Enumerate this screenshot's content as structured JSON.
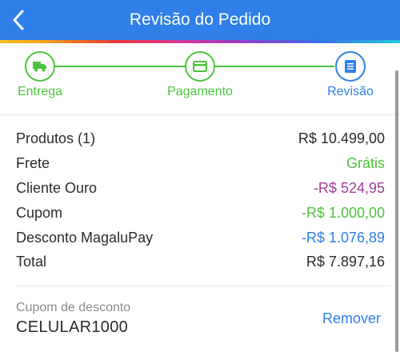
{
  "header": {
    "title": "Revisão do Pedido",
    "back_icon": "chevron-left-icon"
  },
  "steps": [
    {
      "label": "Entrega",
      "icon": "truck-icon",
      "status": "done",
      "color": "#4cc33d"
    },
    {
      "label": "Pagamento",
      "icon": "credit-card-icon",
      "status": "done",
      "color": "#4cc33d"
    },
    {
      "label": "Revisão",
      "icon": "document-icon",
      "status": "current",
      "color": "#2f7fe8"
    }
  ],
  "summary": {
    "rows": [
      {
        "label": "Produtos (1)",
        "value": "R$ 10.499,00",
        "color": "#2b2b2b"
      },
      {
        "label": "Frete",
        "value": "Grátis",
        "color": "#4cc33d"
      },
      {
        "label": "Cliente Ouro",
        "value": "-R$ 524,95",
        "color": "#9c3f97"
      },
      {
        "label": "Cupom",
        "value": "-R$ 1.000,00",
        "color": "#4cc33d"
      },
      {
        "label": "Desconto MagaluPay",
        "value": "-R$ 1.076,89",
        "color": "#2f7fe8"
      }
    ],
    "total": {
      "label": "Total",
      "value": "R$ 7.897,16"
    }
  },
  "coupon": {
    "caption": "Cupom de desconto",
    "code": "CELULAR1000",
    "remove_label": "Remover"
  },
  "colors": {
    "primary": "#2f7fe8",
    "success": "#4cc33d",
    "gold": "#9c3f97"
  }
}
